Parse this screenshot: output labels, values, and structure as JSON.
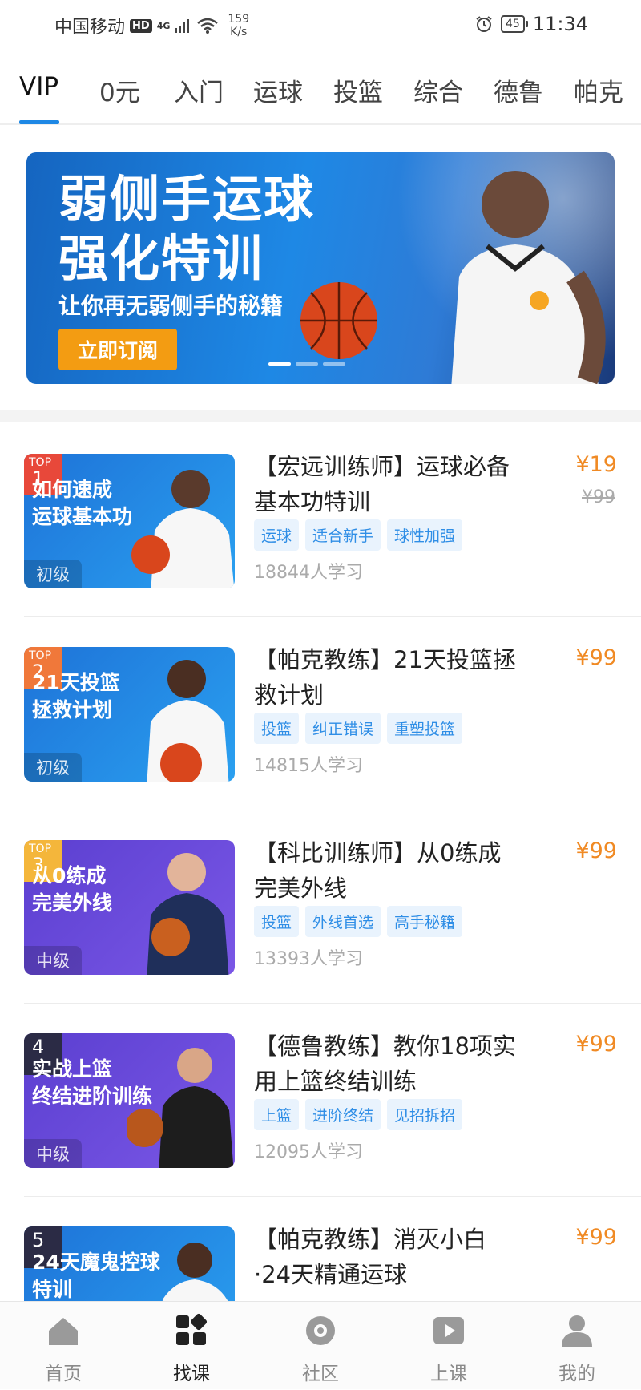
{
  "status_bar": {
    "carrier": "中国移动",
    "hd": "HD",
    "network": "4G",
    "speed_value": "159",
    "speed_unit": "K/s",
    "battery": "45",
    "time": "11:34"
  },
  "tabs": [
    {
      "label": "VIP",
      "active": true
    },
    {
      "label": "0元"
    },
    {
      "label": "入门"
    },
    {
      "label": "运球"
    },
    {
      "label": "投篮"
    },
    {
      "label": "综合"
    },
    {
      "label": "德鲁"
    },
    {
      "label": "帕克"
    }
  ],
  "banner": {
    "title_line1": "弱侧手运球",
    "title_line2": "强化特训",
    "subtitle": "让你再无弱侧手的秘籍",
    "button": "立即订阅",
    "slides": 3,
    "active_slide": 1
  },
  "courses": [
    {
      "rank_label": "TOP",
      "rank": "1",
      "thumb_line1": "如何速成",
      "thumb_line2": "运球基本功",
      "level": "初级",
      "title": "【宏远训练师】运球必备基本功特训",
      "price": "¥19",
      "original_price": "¥99",
      "tags": [
        "运球",
        "适合新手",
        "球性加强"
      ],
      "learners": "18844人学习"
    },
    {
      "rank_label": "TOP",
      "rank": "2",
      "thumb_line1": "21天投篮",
      "thumb_line2": "拯救计划",
      "level": "初级",
      "title": "【帕克教练】21天投篮拯救计划",
      "price": "¥99",
      "tags": [
        "投篮",
        "纠正错误",
        "重塑投篮"
      ],
      "learners": "14815人学习"
    },
    {
      "rank_label": "TOP",
      "rank": "3",
      "thumb_line1": "从0练成",
      "thumb_line2": "完美外线",
      "level": "中级",
      "title": "【科比训练师】从0练成完美外线",
      "price": "¥99",
      "tags": [
        "投篮",
        "外线首选",
        "高手秘籍"
      ],
      "learners": "13393人学习"
    },
    {
      "rank": "4",
      "thumb_line1": "实战上篮",
      "thumb_line2": "终结进阶训练",
      "level": "中级",
      "title": "【德鲁教练】教你18项实用上篮终结训练",
      "price": "¥99",
      "tags": [
        "上篮",
        "进阶终结",
        "见招拆招"
      ],
      "learners": "12095人学习"
    },
    {
      "rank": "5",
      "thumb_line1": "24天魔鬼控球",
      "thumb_line2": "特训",
      "level": "",
      "title": "【帕克教练】消灭小白·24天精通运球",
      "price": "¥99",
      "tags": [],
      "learners": ""
    }
  ],
  "bottom_nav": [
    {
      "label": "首页",
      "icon": "home-icon"
    },
    {
      "label": "找课",
      "icon": "grid-icon",
      "active": true
    },
    {
      "label": "社区",
      "icon": "community-icon"
    },
    {
      "label": "上课",
      "icon": "play-icon"
    },
    {
      "label": "我的",
      "icon": "user-icon"
    }
  ],
  "colors": {
    "accent": "#1e88e5",
    "price": "#f08a24",
    "tag_bg": "#e9f3fd",
    "tag_text": "#2f8ee6",
    "rank_red": "#e8483a",
    "rank_yellow": "#f4b63b",
    "rank_dark": "#2b2b45"
  }
}
